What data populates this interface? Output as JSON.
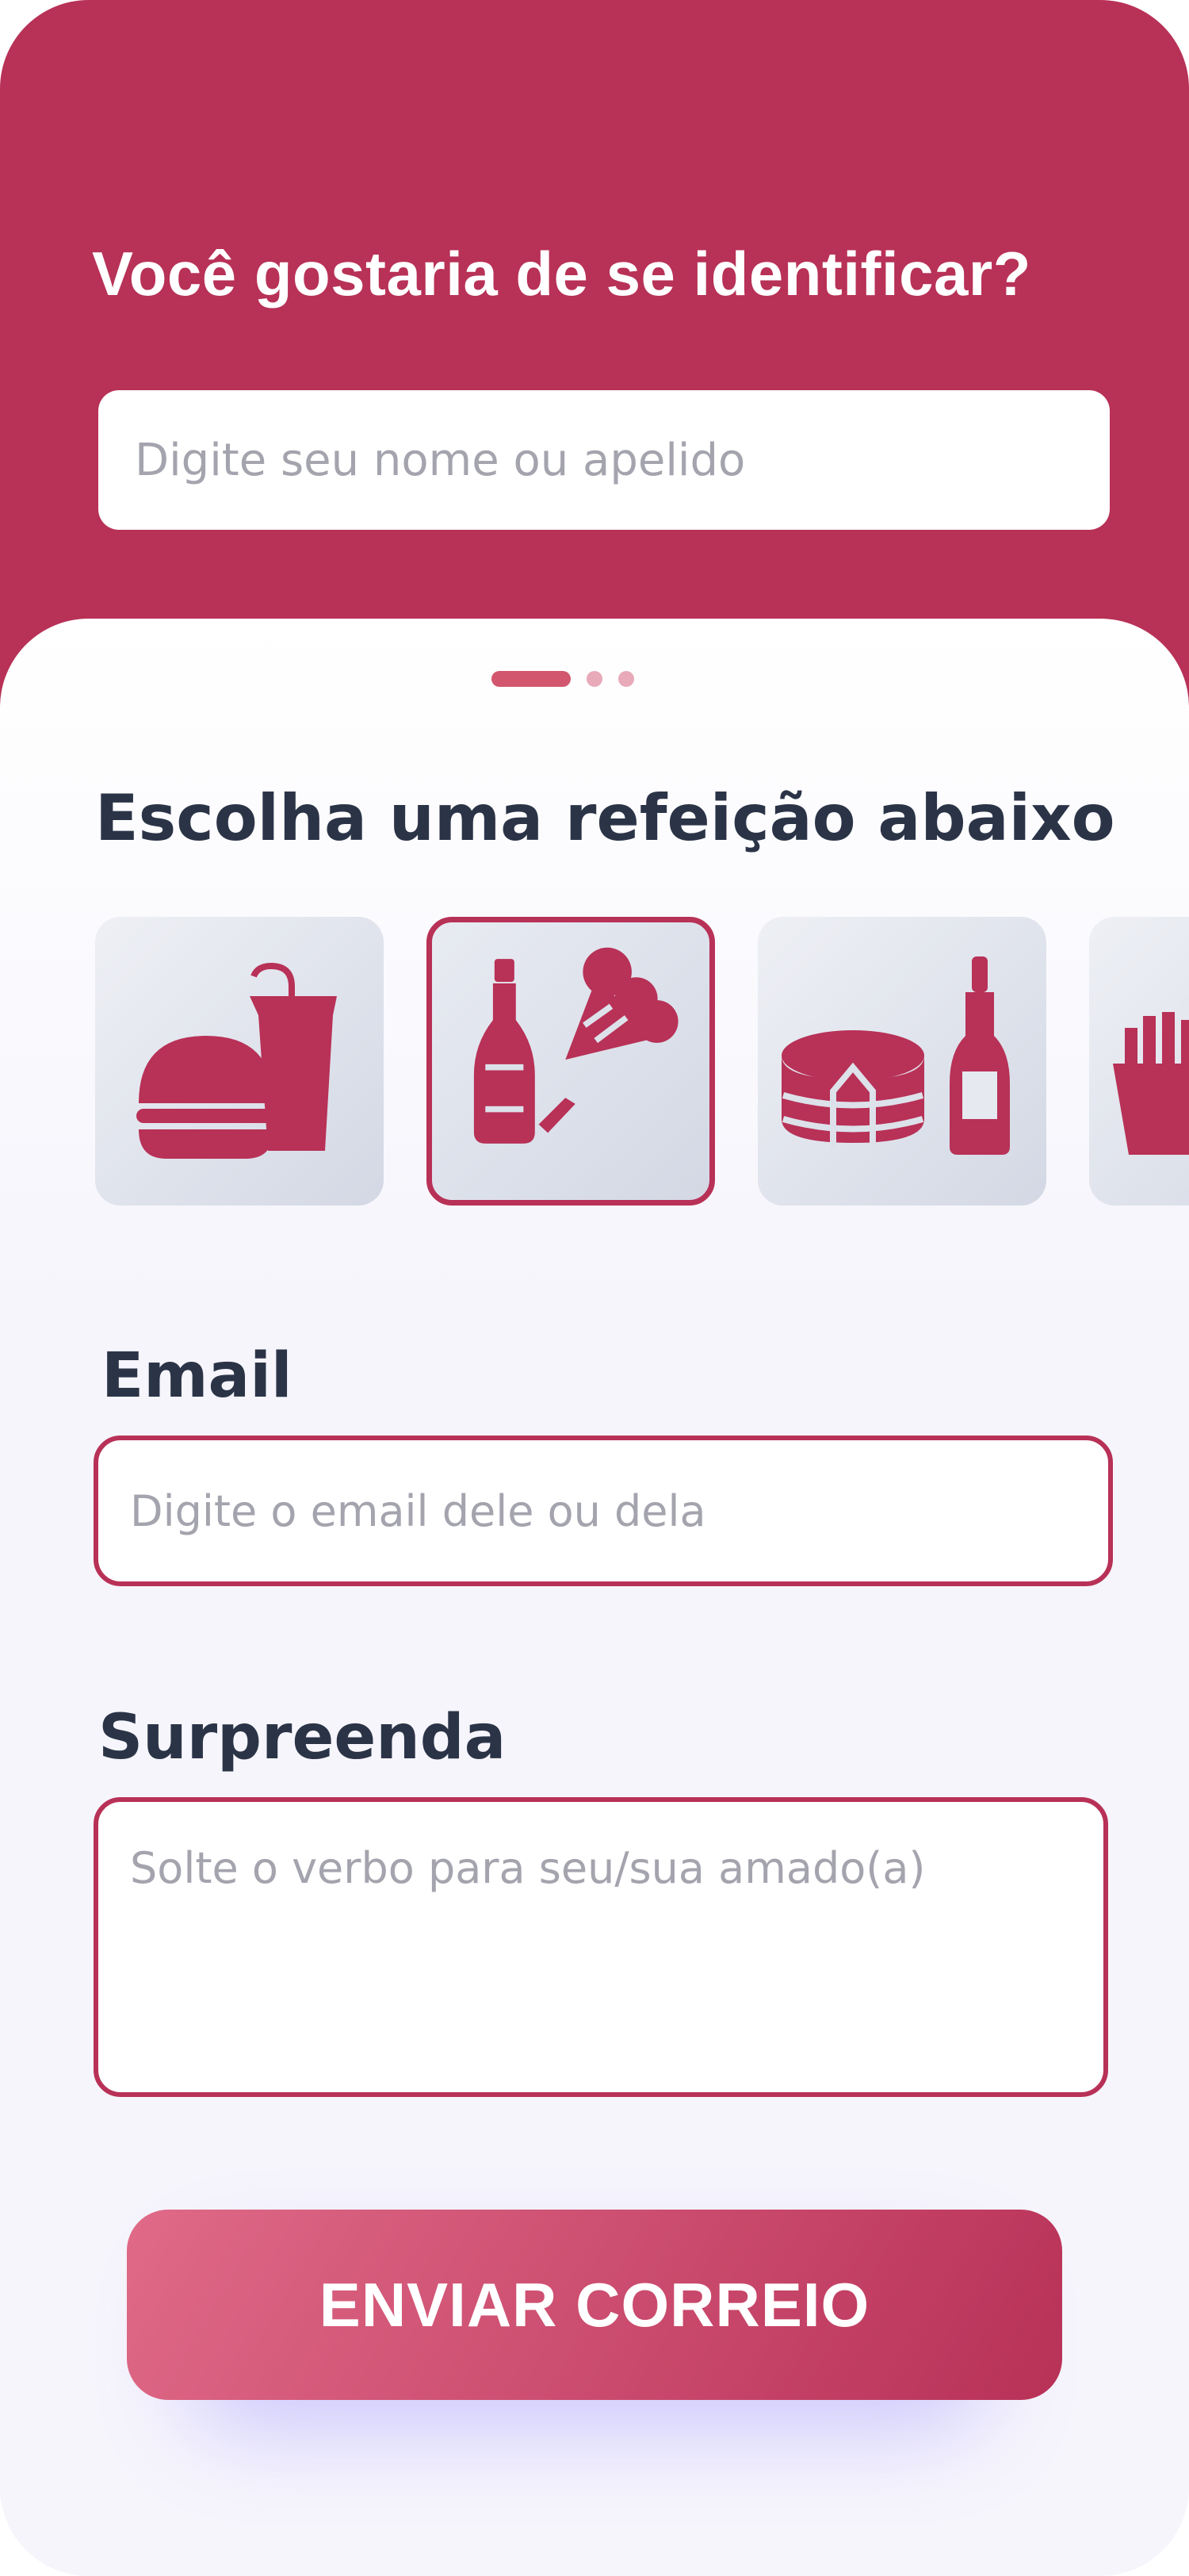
{
  "header": {
    "title": "Você gostaria de se identificar?",
    "name_placeholder": "Digite seu nome ou apelido"
  },
  "pager": {
    "pages": 3,
    "active": 1
  },
  "meals": {
    "title": "Escolha uma refeição abaixo",
    "options": [
      {
        "icon": "burger-soda-icon",
        "selected": false
      },
      {
        "icon": "champagne-icecream-icon",
        "selected": true
      },
      {
        "icon": "cake-wine-icon",
        "selected": false
      },
      {
        "icon": "fries-icon",
        "selected": false
      }
    ]
  },
  "email": {
    "label": "Email",
    "placeholder": "Digite o email dele ou dela"
  },
  "message": {
    "label": "Surpreenda",
    "placeholder": "Solte o verbo para seu/sua amado(a)"
  },
  "submit": {
    "label": "ENVIAR CORREIO"
  },
  "colors": {
    "brand": "#b83157",
    "text_dark": "#2b3447",
    "placeholder": "#a4a4ae",
    "background": "#f6f5fc"
  }
}
